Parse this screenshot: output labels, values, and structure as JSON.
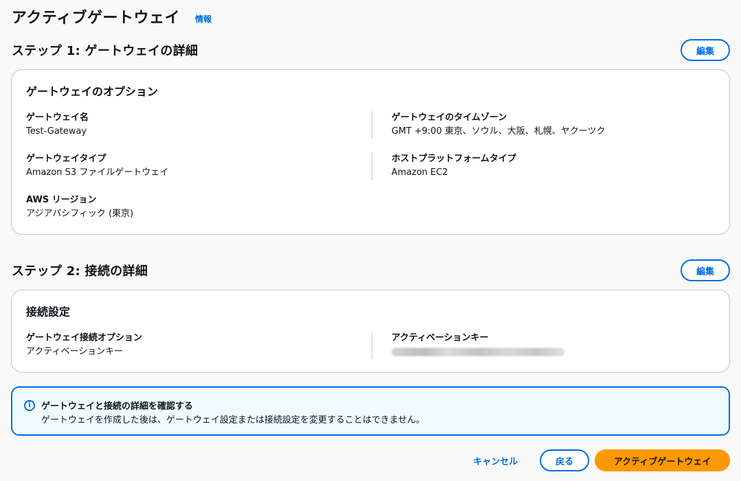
{
  "page": {
    "title": "アクティブゲートウェイ",
    "info_link": "情報"
  },
  "step1": {
    "title": "ステップ 1: ゲートウェイの詳細",
    "edit_label": "編集",
    "section_title": "ゲートウェイのオプション",
    "gateway_name": {
      "label": "ゲートウェイ名",
      "value": "Test-Gateway"
    },
    "gateway_type": {
      "label": "ゲートウェイタイプ",
      "value": "Amazon S3 ファイルゲートウェイ"
    },
    "aws_region": {
      "label": "AWS リージョン",
      "value": "アジアパシフィック (東京)"
    },
    "timezone": {
      "label": "ゲートウェイのタイムゾーン",
      "value": "GMT +9:00 東京、ソウル、大阪、札幌、ヤクーツク"
    },
    "host_platform": {
      "label": "ホストプラットフォームタイプ",
      "value": "Amazon EC2"
    }
  },
  "step2": {
    "title": "ステップ 2: 接続の詳細",
    "edit_label": "編集",
    "section_title": "接続設定",
    "connection_option": {
      "label": "ゲートウェイ接続オプション",
      "value": "アクティベーションキー"
    },
    "activation_key": {
      "label": "アクティベーションキー"
    }
  },
  "alert": {
    "icon": "info-icon",
    "title": "ゲートウェイと接続の詳細を確認する",
    "message": "ゲートウェイを作成した後は、ゲートウェイ設定または接続設定を変更することはできません。"
  },
  "footer": {
    "cancel_label": "キャンセル",
    "back_label": "戻る",
    "submit_label": "アクティブゲートウェイ"
  },
  "colors": {
    "accent": "#006ce0",
    "primary_button": "#ff9900",
    "alert_background": "#f0fbff",
    "card_border": "#c6c6cd"
  }
}
